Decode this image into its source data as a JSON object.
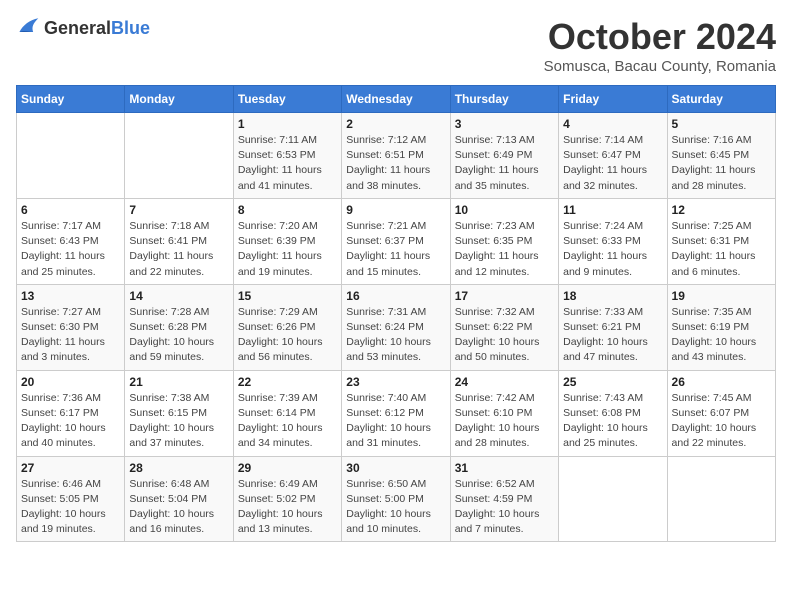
{
  "header": {
    "logo_general": "General",
    "logo_blue": "Blue",
    "month_title": "October 2024",
    "location": "Somusca, Bacau County, Romania"
  },
  "weekdays": [
    "Sunday",
    "Monday",
    "Tuesday",
    "Wednesday",
    "Thursday",
    "Friday",
    "Saturday"
  ],
  "weeks": [
    [
      {
        "day": "",
        "sunrise": "",
        "sunset": "",
        "daylight": ""
      },
      {
        "day": "",
        "sunrise": "",
        "sunset": "",
        "daylight": ""
      },
      {
        "day": "1",
        "sunrise": "Sunrise: 7:11 AM",
        "sunset": "Sunset: 6:53 PM",
        "daylight": "Daylight: 11 hours and 41 minutes."
      },
      {
        "day": "2",
        "sunrise": "Sunrise: 7:12 AM",
        "sunset": "Sunset: 6:51 PM",
        "daylight": "Daylight: 11 hours and 38 minutes."
      },
      {
        "day": "3",
        "sunrise": "Sunrise: 7:13 AM",
        "sunset": "Sunset: 6:49 PM",
        "daylight": "Daylight: 11 hours and 35 minutes."
      },
      {
        "day": "4",
        "sunrise": "Sunrise: 7:14 AM",
        "sunset": "Sunset: 6:47 PM",
        "daylight": "Daylight: 11 hours and 32 minutes."
      },
      {
        "day": "5",
        "sunrise": "Sunrise: 7:16 AM",
        "sunset": "Sunset: 6:45 PM",
        "daylight": "Daylight: 11 hours and 28 minutes."
      }
    ],
    [
      {
        "day": "6",
        "sunrise": "Sunrise: 7:17 AM",
        "sunset": "Sunset: 6:43 PM",
        "daylight": "Daylight: 11 hours and 25 minutes."
      },
      {
        "day": "7",
        "sunrise": "Sunrise: 7:18 AM",
        "sunset": "Sunset: 6:41 PM",
        "daylight": "Daylight: 11 hours and 22 minutes."
      },
      {
        "day": "8",
        "sunrise": "Sunrise: 7:20 AM",
        "sunset": "Sunset: 6:39 PM",
        "daylight": "Daylight: 11 hours and 19 minutes."
      },
      {
        "day": "9",
        "sunrise": "Sunrise: 7:21 AM",
        "sunset": "Sunset: 6:37 PM",
        "daylight": "Daylight: 11 hours and 15 minutes."
      },
      {
        "day": "10",
        "sunrise": "Sunrise: 7:23 AM",
        "sunset": "Sunset: 6:35 PM",
        "daylight": "Daylight: 11 hours and 12 minutes."
      },
      {
        "day": "11",
        "sunrise": "Sunrise: 7:24 AM",
        "sunset": "Sunset: 6:33 PM",
        "daylight": "Daylight: 11 hours and 9 minutes."
      },
      {
        "day": "12",
        "sunrise": "Sunrise: 7:25 AM",
        "sunset": "Sunset: 6:31 PM",
        "daylight": "Daylight: 11 hours and 6 minutes."
      }
    ],
    [
      {
        "day": "13",
        "sunrise": "Sunrise: 7:27 AM",
        "sunset": "Sunset: 6:30 PM",
        "daylight": "Daylight: 11 hours and 3 minutes."
      },
      {
        "day": "14",
        "sunrise": "Sunrise: 7:28 AM",
        "sunset": "Sunset: 6:28 PM",
        "daylight": "Daylight: 10 hours and 59 minutes."
      },
      {
        "day": "15",
        "sunrise": "Sunrise: 7:29 AM",
        "sunset": "Sunset: 6:26 PM",
        "daylight": "Daylight: 10 hours and 56 minutes."
      },
      {
        "day": "16",
        "sunrise": "Sunrise: 7:31 AM",
        "sunset": "Sunset: 6:24 PM",
        "daylight": "Daylight: 10 hours and 53 minutes."
      },
      {
        "day": "17",
        "sunrise": "Sunrise: 7:32 AM",
        "sunset": "Sunset: 6:22 PM",
        "daylight": "Daylight: 10 hours and 50 minutes."
      },
      {
        "day": "18",
        "sunrise": "Sunrise: 7:33 AM",
        "sunset": "Sunset: 6:21 PM",
        "daylight": "Daylight: 10 hours and 47 minutes."
      },
      {
        "day": "19",
        "sunrise": "Sunrise: 7:35 AM",
        "sunset": "Sunset: 6:19 PM",
        "daylight": "Daylight: 10 hours and 43 minutes."
      }
    ],
    [
      {
        "day": "20",
        "sunrise": "Sunrise: 7:36 AM",
        "sunset": "Sunset: 6:17 PM",
        "daylight": "Daylight: 10 hours and 40 minutes."
      },
      {
        "day": "21",
        "sunrise": "Sunrise: 7:38 AM",
        "sunset": "Sunset: 6:15 PM",
        "daylight": "Daylight: 10 hours and 37 minutes."
      },
      {
        "day": "22",
        "sunrise": "Sunrise: 7:39 AM",
        "sunset": "Sunset: 6:14 PM",
        "daylight": "Daylight: 10 hours and 34 minutes."
      },
      {
        "day": "23",
        "sunrise": "Sunrise: 7:40 AM",
        "sunset": "Sunset: 6:12 PM",
        "daylight": "Daylight: 10 hours and 31 minutes."
      },
      {
        "day": "24",
        "sunrise": "Sunrise: 7:42 AM",
        "sunset": "Sunset: 6:10 PM",
        "daylight": "Daylight: 10 hours and 28 minutes."
      },
      {
        "day": "25",
        "sunrise": "Sunrise: 7:43 AM",
        "sunset": "Sunset: 6:08 PM",
        "daylight": "Daylight: 10 hours and 25 minutes."
      },
      {
        "day": "26",
        "sunrise": "Sunrise: 7:45 AM",
        "sunset": "Sunset: 6:07 PM",
        "daylight": "Daylight: 10 hours and 22 minutes."
      }
    ],
    [
      {
        "day": "27",
        "sunrise": "Sunrise: 6:46 AM",
        "sunset": "Sunset: 5:05 PM",
        "daylight": "Daylight: 10 hours and 19 minutes."
      },
      {
        "day": "28",
        "sunrise": "Sunrise: 6:48 AM",
        "sunset": "Sunset: 5:04 PM",
        "daylight": "Daylight: 10 hours and 16 minutes."
      },
      {
        "day": "29",
        "sunrise": "Sunrise: 6:49 AM",
        "sunset": "Sunset: 5:02 PM",
        "daylight": "Daylight: 10 hours and 13 minutes."
      },
      {
        "day": "30",
        "sunrise": "Sunrise: 6:50 AM",
        "sunset": "Sunset: 5:00 PM",
        "daylight": "Daylight: 10 hours and 10 minutes."
      },
      {
        "day": "31",
        "sunrise": "Sunrise: 6:52 AM",
        "sunset": "Sunset: 4:59 PM",
        "daylight": "Daylight: 10 hours and 7 minutes."
      },
      {
        "day": "",
        "sunrise": "",
        "sunset": "",
        "daylight": ""
      },
      {
        "day": "",
        "sunrise": "",
        "sunset": "",
        "daylight": ""
      }
    ]
  ]
}
